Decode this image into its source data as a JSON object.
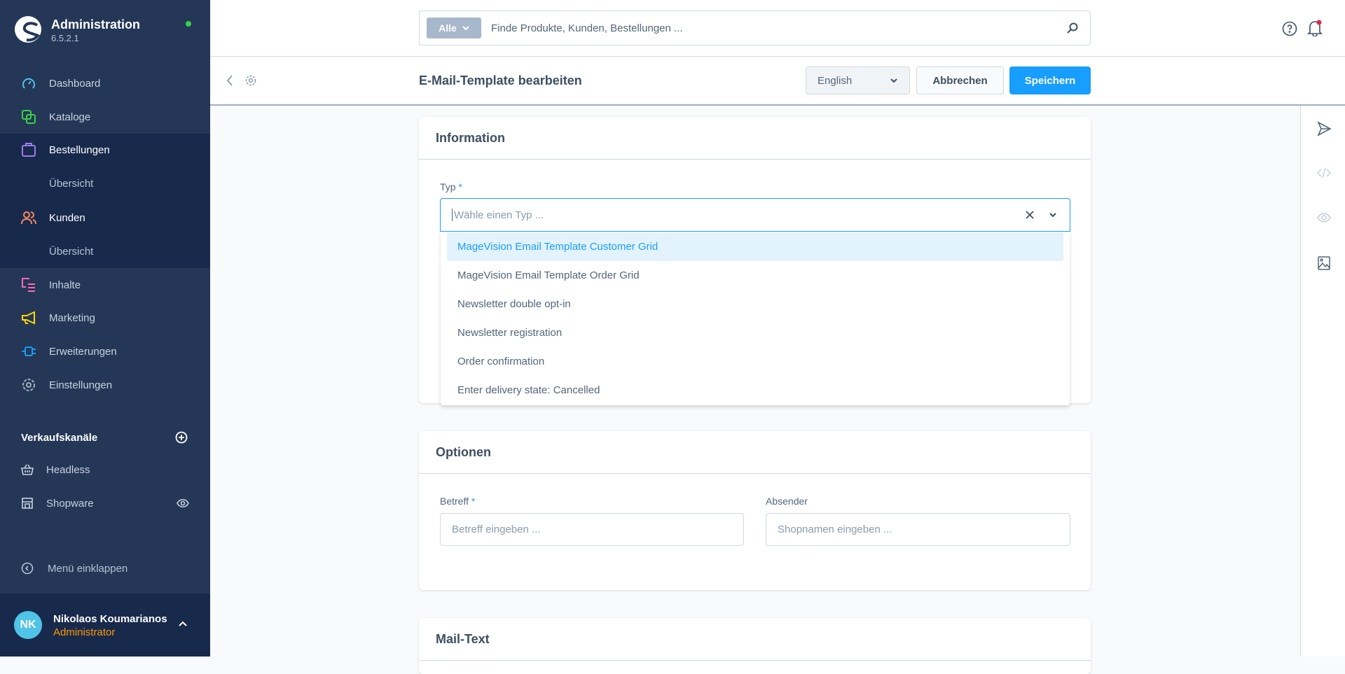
{
  "sidebar": {
    "app_title": "Administration",
    "version": "6.5.2.1",
    "nav": [
      {
        "label": "Dashboard",
        "icon": "dashboard-icon",
        "color": "#4fc3e8"
      },
      {
        "label": "Kataloge",
        "icon": "catalog-icon",
        "color": "#37d046"
      },
      {
        "label": "Bestellungen",
        "icon": "shopping-bag-icon",
        "color": "#9f7aea"
      },
      {
        "label": "Übersicht"
      },
      {
        "label": "Kunden",
        "icon": "users-icon",
        "color": "#f88962"
      },
      {
        "label": "Übersicht"
      },
      {
        "label": "Inhalte",
        "icon": "content-icon",
        "color": "#ff68b4"
      },
      {
        "label": "Marketing",
        "icon": "megaphone-icon",
        "color": "#ffd700"
      },
      {
        "label": "Erweiterungen",
        "icon": "plug-icon",
        "color": "#189eff"
      },
      {
        "label": "Einstellungen",
        "icon": "gear-icon",
        "color": "#a2b0bf"
      }
    ],
    "sales_channels_title": "Verkaufskanäle",
    "channels": [
      {
        "label": "Headless"
      },
      {
        "label": "Shopware"
      }
    ],
    "collapse_label": "Menü einklappen",
    "user": {
      "initials": "NK",
      "name": "Nikolaos Koumarianos",
      "role": "Administrator"
    }
  },
  "topbar": {
    "search_type": "Alle",
    "search_placeholder": "Finde Produkte, Kunden, Bestellungen ..."
  },
  "smartbar": {
    "title": "E-Mail-Template bearbeiten",
    "language": "English",
    "cancel": "Abbrechen",
    "save": "Speichern"
  },
  "information": {
    "title": "Information",
    "type_label": "Typ",
    "required": "*",
    "type_placeholder": "Wähle einen Typ ...",
    "options": [
      "MageVision Email Template Customer Grid",
      "MageVision Email Template Order Grid",
      "Newsletter double opt-in",
      "Newsletter registration",
      "Order confirmation",
      "Enter delivery state: Cancelled"
    ]
  },
  "options_card": {
    "title": "Optionen",
    "subject_label": "Betreff",
    "subject_placeholder": "Betreff eingeben ...",
    "sender_label": "Absender",
    "sender_placeholder": "Shopnamen eingeben ..."
  },
  "mailtext": {
    "title": "Mail-Text"
  }
}
